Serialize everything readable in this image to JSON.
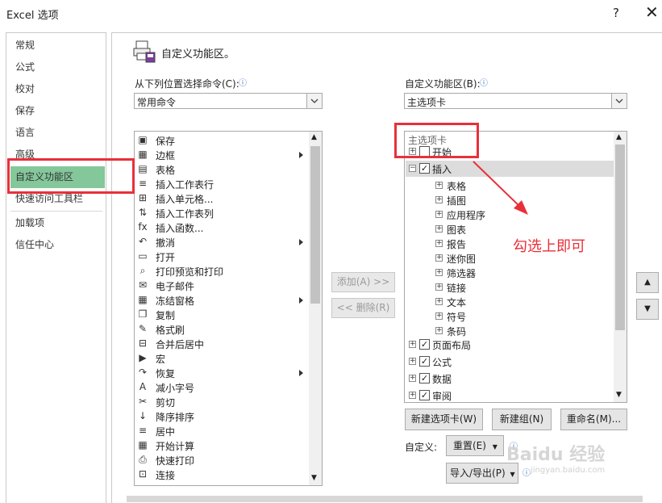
{
  "window": {
    "title": "Excel 选项",
    "help_label": "?",
    "close_label": "✕"
  },
  "nav": {
    "items": [
      {
        "label": "常规"
      },
      {
        "label": "公式"
      },
      {
        "label": "校对"
      },
      {
        "label": "保存"
      },
      {
        "label": "语言"
      },
      {
        "label": "高级"
      },
      {
        "label": "自定义功能区"
      },
      {
        "label": "快速访问工具栏"
      },
      {
        "label": "加载项"
      },
      {
        "label": "信任中心"
      }
    ],
    "selected_index": 6
  },
  "heading": "自定义功能区。",
  "left_panel": {
    "label": "从下列位置选择命令(C):",
    "info_icon": "info-icon",
    "combo_value": "常用命令",
    "commands": [
      {
        "label": "保存",
        "icon": "save-icon",
        "glyph": "▣"
      },
      {
        "label": "边框",
        "icon": "border-icon",
        "glyph": "▦",
        "submenu": true
      },
      {
        "label": "表格",
        "icon": "table-icon",
        "glyph": "▤"
      },
      {
        "label": "插入工作表行",
        "icon": "insert-row-icon",
        "glyph": "≡"
      },
      {
        "label": "插入单元格...",
        "icon": "insert-cell-icon",
        "glyph": "⊞"
      },
      {
        "label": "插入工作表列",
        "icon": "insert-column-icon",
        "glyph": "⇅"
      },
      {
        "label": "插入函数...",
        "icon": "function-icon",
        "glyph": "fx"
      },
      {
        "label": "撤消",
        "icon": "undo-icon",
        "glyph": "↶",
        "submenu": true
      },
      {
        "label": "打开",
        "icon": "folder-icon",
        "glyph": "▭"
      },
      {
        "label": "打印预览和打印",
        "icon": "print-preview-icon",
        "glyph": "⌕"
      },
      {
        "label": "电子邮件",
        "icon": "email-icon",
        "glyph": "✉"
      },
      {
        "label": "冻结窗格",
        "icon": "freeze-panes-icon",
        "glyph": "▦",
        "submenu": true
      },
      {
        "label": "复制",
        "icon": "copy-icon",
        "glyph": "❐"
      },
      {
        "label": "格式刷",
        "icon": "format-painter-icon",
        "glyph": "✎"
      },
      {
        "label": "合并后居中",
        "icon": "merge-center-icon",
        "glyph": "⊟"
      },
      {
        "label": "宏",
        "icon": "macro-icon",
        "glyph": "▶"
      },
      {
        "label": "恢复",
        "icon": "redo-icon",
        "glyph": "↷",
        "submenu": true
      },
      {
        "label": "减小字号",
        "icon": "decrease-font-icon",
        "glyph": "A"
      },
      {
        "label": "剪切",
        "icon": "cut-icon",
        "glyph": "✂"
      },
      {
        "label": "降序排序",
        "icon": "sort-desc-icon",
        "glyph": "↓"
      },
      {
        "label": "居中",
        "icon": "align-center-icon",
        "glyph": "≡"
      },
      {
        "label": "开始计算",
        "icon": "calculate-icon",
        "glyph": "▦"
      },
      {
        "label": "快速打印",
        "icon": "quick-print-icon",
        "glyph": "⎙"
      },
      {
        "label": "连接",
        "icon": "connections-icon",
        "glyph": "⊡"
      }
    ]
  },
  "middle": {
    "add_label": "添加(A) >>",
    "remove_label": "<< 删除(R)"
  },
  "right_panel": {
    "label": "自定义功能区(B):",
    "combo_value": "主选项卡",
    "tree_header": "主选项卡",
    "tree": [
      {
        "label": "开始",
        "level": 0,
        "expander": "+",
        "checked": false
      },
      {
        "label": "插入",
        "level": 0,
        "expander": "−",
        "checked": true,
        "selected": true
      },
      {
        "label": "表格",
        "level": 1,
        "expander": "+"
      },
      {
        "label": "插图",
        "level": 1,
        "expander": "+"
      },
      {
        "label": "应用程序",
        "level": 1,
        "expander": "+"
      },
      {
        "label": "图表",
        "level": 1,
        "expander": "+"
      },
      {
        "label": "报告",
        "level": 1,
        "expander": "+"
      },
      {
        "label": "迷你图",
        "level": 1,
        "expander": "+"
      },
      {
        "label": "筛选器",
        "level": 1,
        "expander": "+"
      },
      {
        "label": "链接",
        "level": 1,
        "expander": "+"
      },
      {
        "label": "文本",
        "level": 1,
        "expander": "+"
      },
      {
        "label": "符号",
        "level": 1,
        "expander": "+"
      },
      {
        "label": "条码",
        "level": 1,
        "expander": "+"
      },
      {
        "label": "页面布局",
        "level": 0,
        "expander": "+",
        "checked": true
      },
      {
        "label": "公式",
        "level": 0,
        "expander": "+",
        "checked": true
      },
      {
        "label": "数据",
        "level": 0,
        "expander": "+",
        "checked": true
      },
      {
        "label": "审阅",
        "level": 0,
        "expander": "+",
        "checked": true
      }
    ],
    "new_tab_label": "新建选项卡(W)",
    "new_group_label": "新建组(N)",
    "rename_label": "重命名(M)...",
    "customize_label": "自定义:",
    "reset_label": "重置(E)",
    "import_export_label": "导入/导出(P)"
  },
  "annotation": {
    "text": "勾选上即可",
    "color": "#e8303a"
  },
  "watermark": {
    "brand": "Baidu 经验",
    "url": "jingyan.baidu.com"
  }
}
